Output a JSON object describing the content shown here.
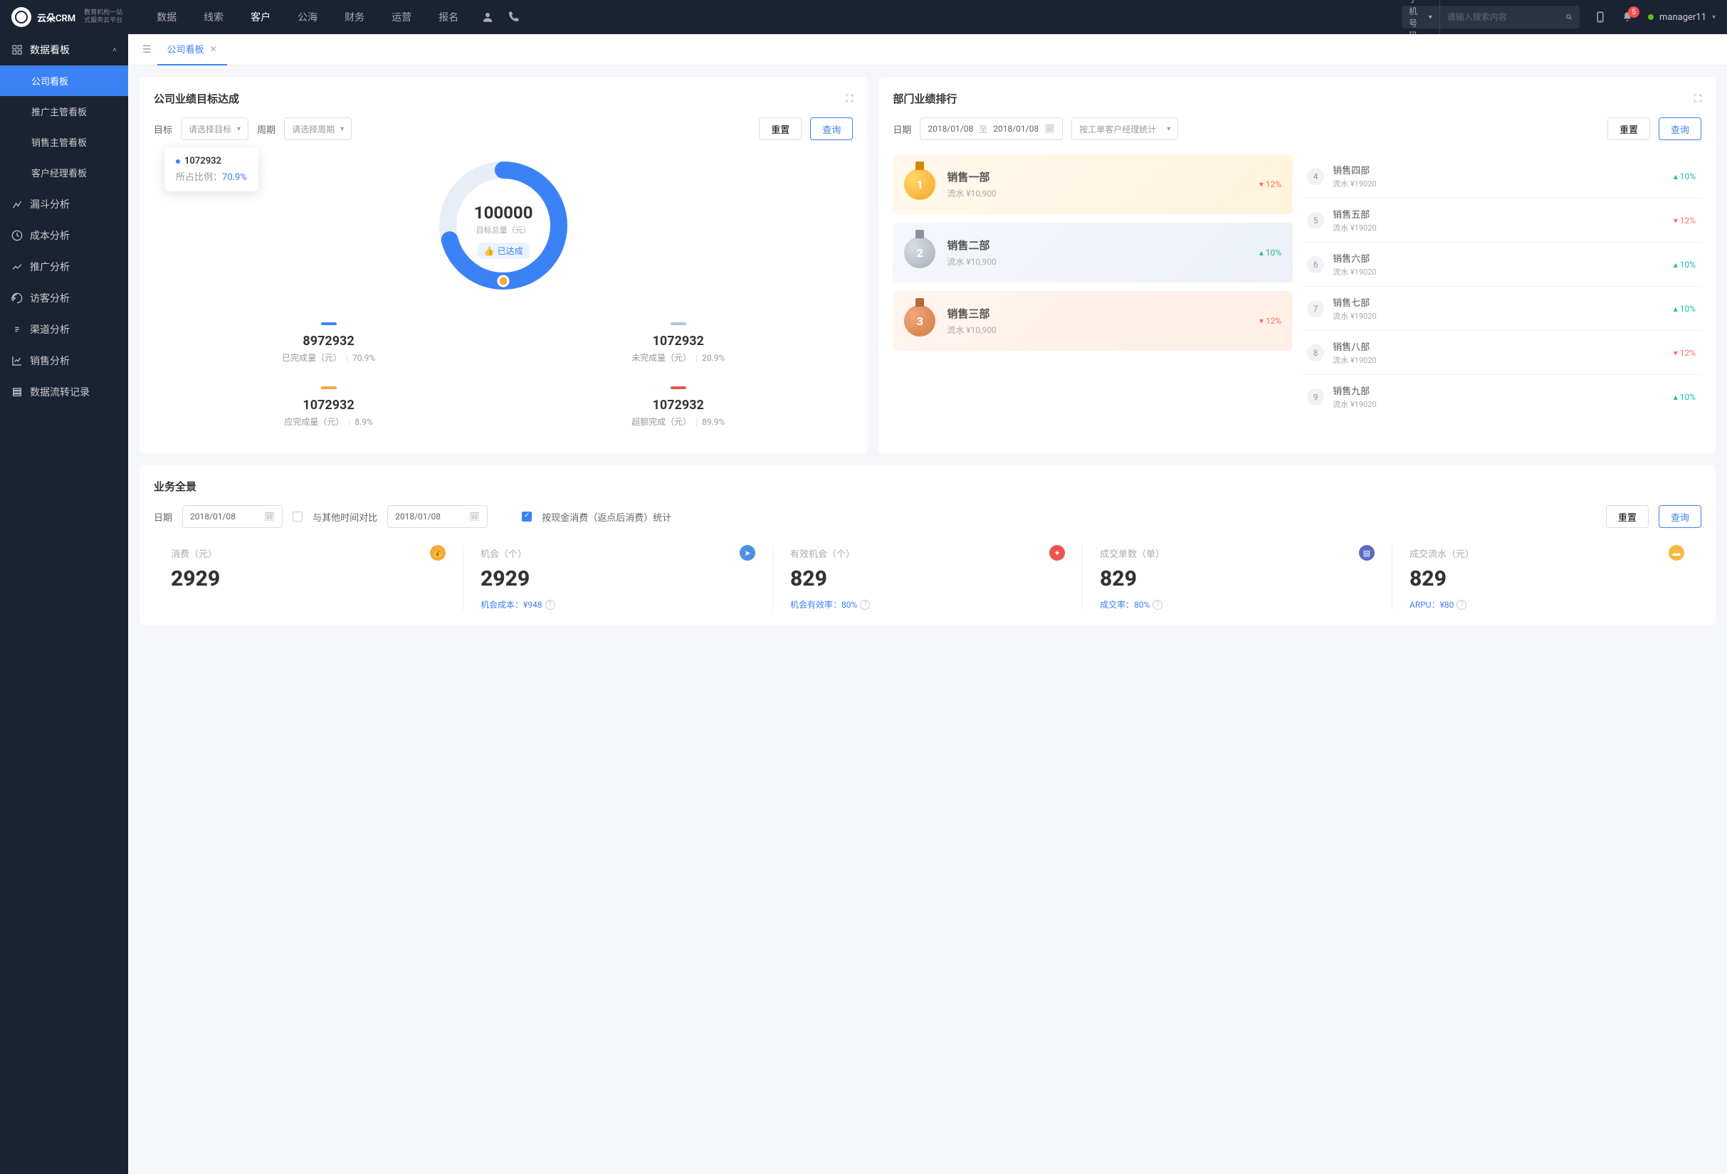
{
  "topbar": {
    "logo_text": "云朵CRM",
    "logo_sub1": "教育机构一站",
    "logo_sub2": "式服务云平台",
    "nav": [
      "数据",
      "线索",
      "客户",
      "公海",
      "财务",
      "运营",
      "报名"
    ],
    "nav_active": 2,
    "search_type": "手机号码",
    "search_placeholder": "请输入搜索内容",
    "notif_count": "5",
    "username": "manager11"
  },
  "sidebar": {
    "group_title": "数据看板",
    "subs": [
      "公司看板",
      "推广主管看板",
      "销售主管看板",
      "客户经理看板"
    ],
    "sub_active": 0,
    "items": [
      "漏斗分析",
      "成本分析",
      "推广分析",
      "访客分析",
      "渠道分析",
      "销售分析",
      "数据流转记录"
    ]
  },
  "tabs": {
    "active_tab": "公司看板"
  },
  "goal_card": {
    "title": "公司业绩目标达成",
    "target_label": "目标",
    "target_placeholder": "请选择目标",
    "period_label": "周期",
    "period_placeholder": "请选择周期",
    "reset": "重置",
    "query": "查询",
    "tooltip_value": "1072932",
    "tooltip_label": "所占比例：",
    "tooltip_pct": "70.9%",
    "center_value": "100000",
    "center_label": "目标总量（元）",
    "badge": "已达成",
    "stats": [
      {
        "num": "8972932",
        "label": "已完成量（元）",
        "pct": "70.9%",
        "bar": "blue"
      },
      {
        "num": "1072932",
        "label": "未完成量（元）",
        "pct": "20.9%",
        "bar": "lightblue"
      },
      {
        "num": "1072932",
        "label": "应完成量（元）",
        "pct": "8.9%",
        "bar": "orange"
      },
      {
        "num": "1072932",
        "label": "超额完成（元）",
        "pct": "89.9%",
        "bar": "red"
      }
    ]
  },
  "rank_card": {
    "title": "部门业绩排行",
    "date_label": "日期",
    "date_from": "2018/01/08",
    "date_to": "2018/01/08",
    "date_sep": "至",
    "mode": "按工单客户经理统计",
    "reset": "重置",
    "query": "查询",
    "top3": [
      {
        "rank": "1",
        "name": "销售一部",
        "sub": "流水 ¥10,900",
        "pct": "12%",
        "dir": "down",
        "cls": "gold"
      },
      {
        "rank": "2",
        "name": "销售二部",
        "sub": "流水 ¥10,900",
        "pct": "10%",
        "dir": "up",
        "cls": "silver"
      },
      {
        "rank": "3",
        "name": "销售三部",
        "sub": "流水 ¥10,900",
        "pct": "12%",
        "dir": "down",
        "cls": "bronze"
      }
    ],
    "rest": [
      {
        "no": "4",
        "name": "销售四部",
        "sub": "流水 ¥19020",
        "pct": "10%",
        "dir": "up"
      },
      {
        "no": "5",
        "name": "销售五部",
        "sub": "流水 ¥19020",
        "pct": "12%",
        "dir": "down"
      },
      {
        "no": "6",
        "name": "销售六部",
        "sub": "流水 ¥19020",
        "pct": "10%",
        "dir": "up"
      },
      {
        "no": "7",
        "name": "销售七部",
        "sub": "流水 ¥19020",
        "pct": "10%",
        "dir": "up"
      },
      {
        "no": "8",
        "name": "销售八部",
        "sub": "流水 ¥19020",
        "pct": "12%",
        "dir": "down"
      },
      {
        "no": "9",
        "name": "销售九部",
        "sub": "流水 ¥19020",
        "pct": "10%",
        "dir": "up"
      }
    ]
  },
  "overview": {
    "title": "业务全景",
    "date_label": "日期",
    "date1": "2018/01/08",
    "compare_label": "与其他时间对比",
    "date2": "2018/01/08",
    "check_label": "按现金消费（返点后消费）统计",
    "reset": "重置",
    "query": "查询",
    "kpis": [
      {
        "label": "消费（元）",
        "value": "2929",
        "sub": "",
        "icon": "orange",
        "glyph": "💰"
      },
      {
        "label": "机会（个）",
        "value": "2929",
        "sub": "机会成本：¥948",
        "icon": "blue",
        "glyph": "➤"
      },
      {
        "label": "有效机会（个）",
        "value": "829",
        "sub": "机会有效率：80%",
        "icon": "red",
        "glyph": "✦"
      },
      {
        "label": "成交单数（单）",
        "value": "829",
        "sub": "成交率：80%",
        "icon": "purple",
        "glyph": "▤"
      },
      {
        "label": "成交流水（元）",
        "value": "829",
        "sub": "ARPU：¥80",
        "icon": "yellow",
        "glyph": "▬"
      }
    ]
  },
  "chart_data": {
    "type": "pie",
    "title": "公司业绩目标达成",
    "total_target": 100000,
    "series": [
      {
        "name": "已完成量（元）",
        "value": 8972932,
        "pct": 70.9
      },
      {
        "name": "未完成量（元）",
        "value": 1072932,
        "pct": 20.9
      },
      {
        "name": "应完成量（元）",
        "value": 1072932,
        "pct": 8.9
      },
      {
        "name": "超额完成（元）",
        "value": 1072932,
        "pct": 89.9
      }
    ]
  }
}
